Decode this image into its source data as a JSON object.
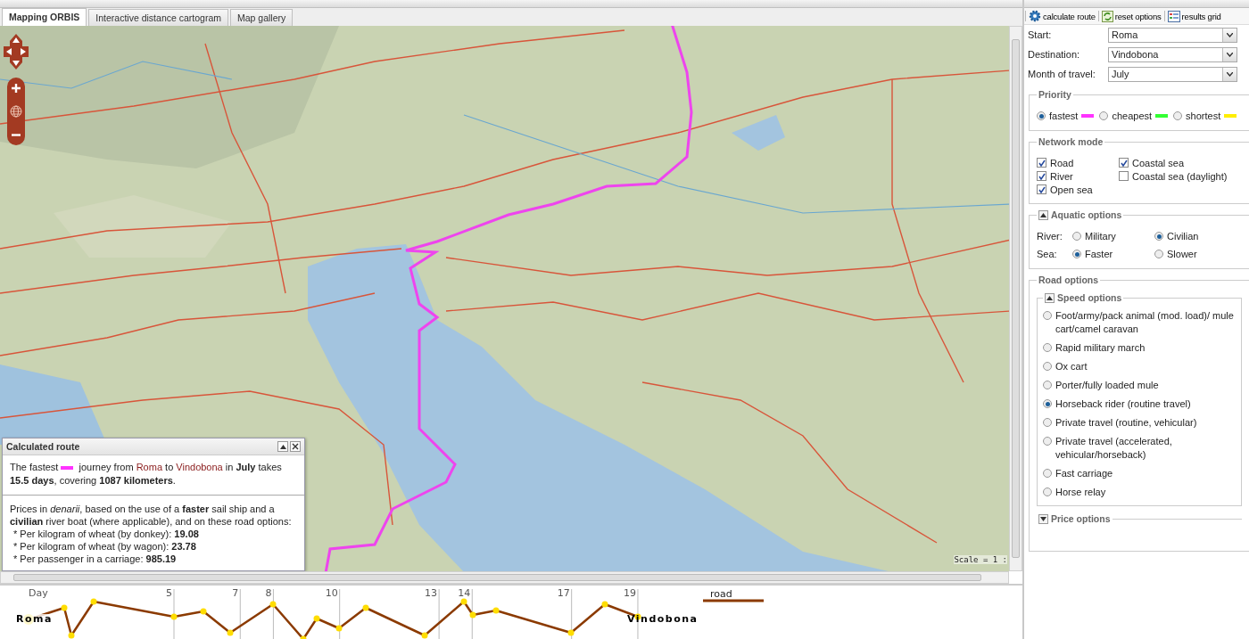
{
  "tabs": [
    {
      "label": "Mapping ORBIS",
      "selected": true
    },
    {
      "label": "Interactive distance cartogram",
      "selected": false
    },
    {
      "label": "Map gallery",
      "selected": false
    }
  ],
  "map": {
    "scale_label": "Scale = 1 :"
  },
  "route_popup": {
    "title": "Calculated route",
    "summary_parts": [
      {
        "kind": "text",
        "text": "The fastest"
      },
      {
        "kind": "swatch",
        "color": "#ff33ff"
      },
      {
        "kind": "text",
        "text": " journey from "
      },
      {
        "kind": "place",
        "text": "Roma"
      },
      {
        "kind": "text",
        "text": " to "
      },
      {
        "kind": "place",
        "text": "Vindobona"
      },
      {
        "kind": "text",
        "text": " in "
      },
      {
        "kind": "bold",
        "text": "July"
      },
      {
        "kind": "text",
        "text": " takes "
      },
      {
        "kind": "bold",
        "text": "15.5 days"
      },
      {
        "kind": "text",
        "text": ", covering "
      },
      {
        "kind": "bold",
        "text": "1087 kilometers"
      },
      {
        "kind": "text",
        "text": "."
      }
    ],
    "prices_intro": "Prices in *denarii*, based on the use of a **faster** sail ship and a **civilian** river boat (where applicable), and on these road options:",
    "price_lines": [
      "* Per kilogram of wheat (by donkey): **19.08**",
      "* Per kilogram of wheat (by wagon): **23.78**",
      "* Per passenger in a carriage: **985.19**"
    ]
  },
  "timeline": {
    "axis_label": "Day",
    "ticks": [
      "5",
      "7",
      "8",
      "10",
      "13",
      "14",
      "17",
      "19"
    ],
    "start_label": "Roma",
    "end_label": "Vindobona",
    "legend": "road"
  },
  "toolbar": [
    {
      "label": "calculate route",
      "kind": "gear"
    },
    {
      "label": "reset options",
      "kind": "refresh"
    },
    {
      "label": "results grid",
      "kind": "grid"
    }
  ],
  "fields": [
    {
      "label": "Start:",
      "value": "Roma"
    },
    {
      "label": "Destination:",
      "value": "Vindobona"
    },
    {
      "label": "Month of travel:",
      "value": "July"
    }
  ],
  "priority": {
    "title": "Priority",
    "options": [
      {
        "label": "fastest",
        "selected": true,
        "color": "#ff33ff"
      },
      {
        "label": "cheapest",
        "selected": false,
        "color": "#33ff33"
      },
      {
        "label": "shortest",
        "selected": false,
        "color": "#ffee00"
      }
    ]
  },
  "network_mode": {
    "title": "Network mode",
    "options": [
      {
        "label": "Road",
        "checked": true
      },
      {
        "label": "River",
        "checked": true
      },
      {
        "label": "Open sea",
        "checked": true
      },
      {
        "label": "Coastal sea",
        "checked": true
      },
      {
        "label": "Coastal sea (daylight)",
        "checked": false
      }
    ]
  },
  "aquatic_options": {
    "title": "Aquatic options",
    "expanded": true,
    "rows": [
      {
        "label": "River:",
        "options": [
          {
            "label": "Military",
            "selected": false
          },
          {
            "label": "Civilian",
            "selected": true
          }
        ]
      },
      {
        "label": "Sea:",
        "options": [
          {
            "label": "Faster",
            "selected": true
          },
          {
            "label": "Slower",
            "selected": false
          }
        ]
      }
    ]
  },
  "road_options": {
    "title": "Road options",
    "speed_options": {
      "title": "Speed options",
      "expanded": true,
      "options": [
        {
          "label": "Foot/army/pack animal (mod. load)/ mule cart/camel caravan",
          "selected": false
        },
        {
          "label": "Rapid military march",
          "selected": false
        },
        {
          "label": "Ox cart",
          "selected": false
        },
        {
          "label": "Porter/fully loaded mule",
          "selected": false
        },
        {
          "label": "Horseback rider (routine travel)",
          "selected": true
        },
        {
          "label": "Private travel (routine, vehicular)",
          "selected": false
        },
        {
          "label": "Private travel (accelerated, vehicular/horseback)",
          "selected": false
        },
        {
          "label": "Fast carriage",
          "selected": false
        },
        {
          "label": "Horse relay",
          "selected": false
        }
      ]
    },
    "price_options": {
      "title": "Price options",
      "expanded": false
    }
  }
}
